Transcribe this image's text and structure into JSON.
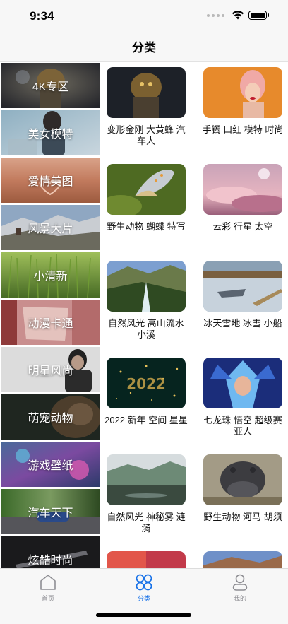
{
  "status_bar": {
    "time": "9:34"
  },
  "nav": {
    "title": "分类"
  },
  "categories": [
    {
      "label": "4K专区"
    },
    {
      "label": "美女模特"
    },
    {
      "label": "爱情美图"
    },
    {
      "label": "风景大片"
    },
    {
      "label": "小清新"
    },
    {
      "label": "动漫卡通"
    },
    {
      "label": "明星风尚"
    },
    {
      "label": "萌宠动物"
    },
    {
      "label": "游戏壁纸"
    },
    {
      "label": "汽车天下"
    },
    {
      "label": "炫酷时尚"
    }
  ],
  "wallpapers": [
    {
      "caption": "变形金刚 大黄蜂 汽车人"
    },
    {
      "caption": "手镯 口红 模特 时尚"
    },
    {
      "caption": "野生动物 蝴蝶 特写"
    },
    {
      "caption": "云彩 行星 太空"
    },
    {
      "caption": "自然风光 高山流水 小溪"
    },
    {
      "caption": "冰天雪地 冰雪 小船"
    },
    {
      "caption": "2022 新年 空间 星星"
    },
    {
      "caption": "七龙珠 悟空 超级赛亚人"
    },
    {
      "caption": "自然风光 神秘雾 涟漪"
    },
    {
      "caption": "野生动物 河马 胡须"
    }
  ],
  "tabs": [
    {
      "label": "首页",
      "icon": "home-icon"
    },
    {
      "label": "分类",
      "icon": "category-grid-icon"
    },
    {
      "label": "我的",
      "icon": "profile-icon"
    }
  ],
  "colors": {
    "accent": "#1a73e8",
    "inactive": "#8e8e93"
  }
}
